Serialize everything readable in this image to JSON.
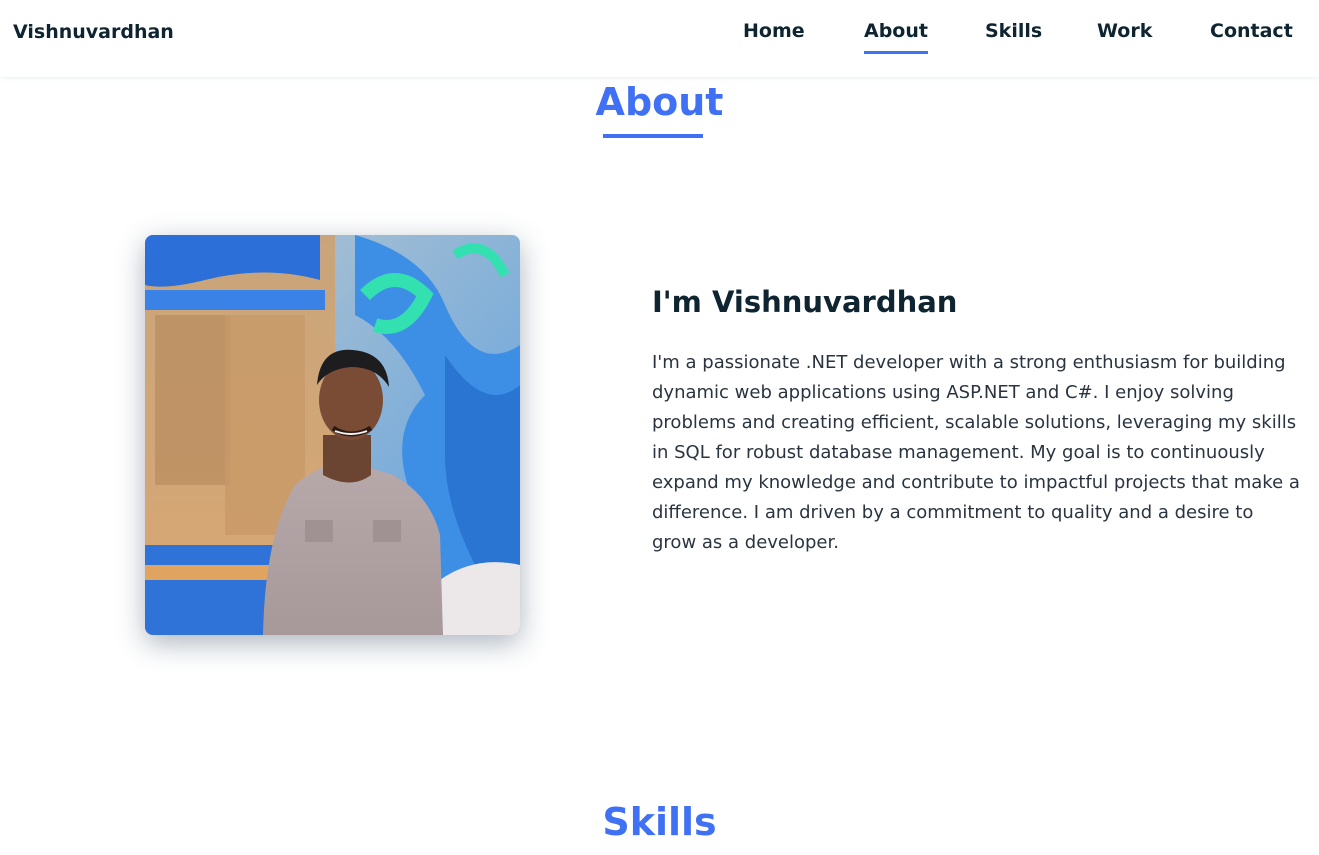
{
  "header": {
    "logo": "Vishnuvardhan",
    "nav": [
      {
        "label": "Home",
        "active": false
      },
      {
        "label": "About",
        "active": true
      },
      {
        "label": "Skills",
        "active": false
      },
      {
        "label": "Work",
        "active": false
      },
      {
        "label": "Contact",
        "active": false
      }
    ]
  },
  "about": {
    "title": "About",
    "heading": "I'm Vishnuvardhan",
    "description": "I'm a passionate .NET developer with a strong enthusiasm for building dynamic web applications using ASP.NET and C#. I enjoy solving problems and creating efficient, scalable solutions, leveraging my skills in SQL for robust database management. My goal is to continuously expand my knowledge and contribute to impactful projects that make a difference. I am driven by a commitment to quality and a desire to grow as a developer."
  },
  "skills": {
    "title": "Skills"
  },
  "colors": {
    "accent": "#4070f4",
    "text_dark": "#0e2431"
  }
}
